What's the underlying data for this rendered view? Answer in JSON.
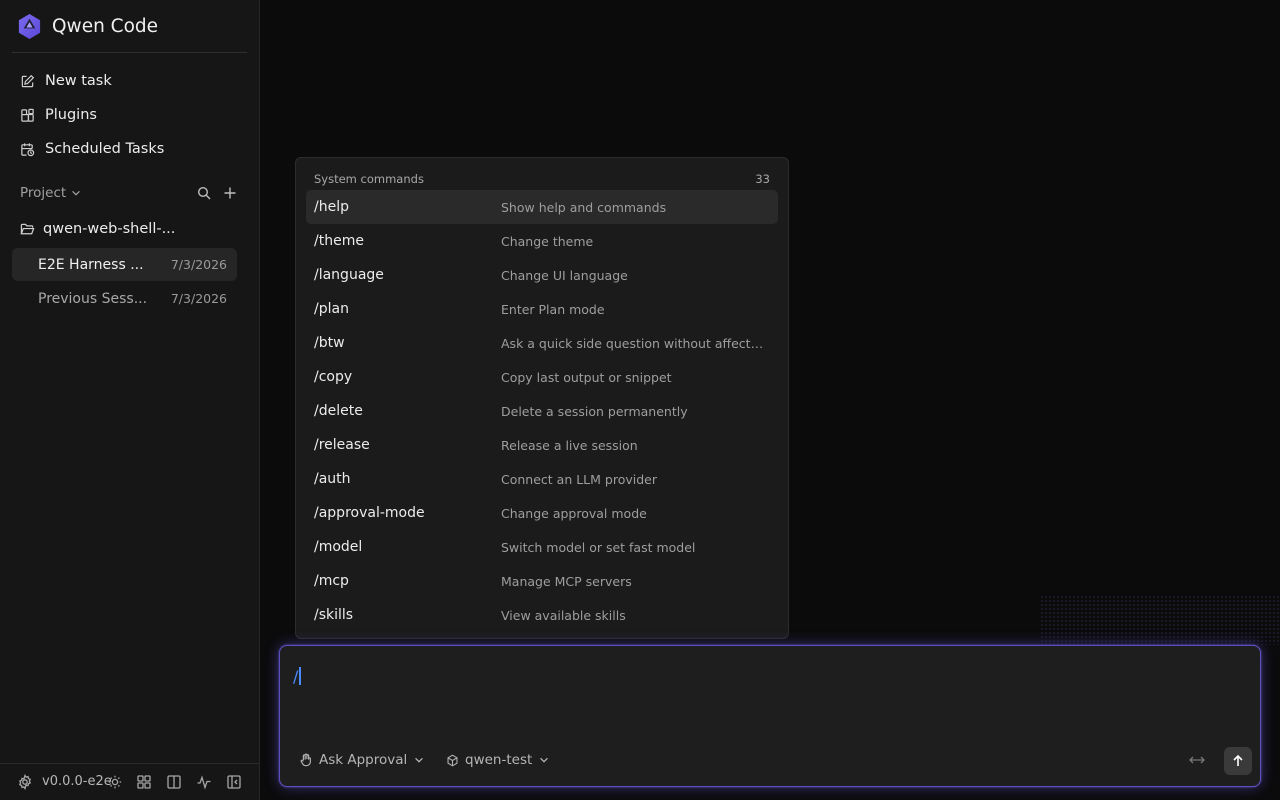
{
  "app": {
    "name": "Qwen Code",
    "version": "v0.0.0-e2e"
  },
  "sidebar": {
    "nav": [
      {
        "label": "New task",
        "icon": "edit-icon"
      },
      {
        "label": "Plugins",
        "icon": "puzzle-icon"
      },
      {
        "label": "Scheduled Tasks",
        "icon": "clock-calendar-icon"
      }
    ],
    "project_label": "Project",
    "folder": "qwen-web-shell-...",
    "sessions": [
      {
        "title": "E2E Harness ...",
        "date": "7/3/2026",
        "active": true
      },
      {
        "title": "Previous Sess...",
        "date": "7/3/2026",
        "active": false
      }
    ]
  },
  "commands": {
    "header": "System commands",
    "count": "33",
    "selected_index": 0,
    "items": [
      {
        "cmd": "/help",
        "desc": "Show help and commands"
      },
      {
        "cmd": "/theme",
        "desc": "Change theme"
      },
      {
        "cmd": "/language",
        "desc": "Change UI language"
      },
      {
        "cmd": "/plan",
        "desc": "Enter Plan mode"
      },
      {
        "cmd": "/btw",
        "desc": "Ask a quick side question without affectin..."
      },
      {
        "cmd": "/copy",
        "desc": "Copy last output or snippet"
      },
      {
        "cmd": "/delete",
        "desc": "Delete a session permanently"
      },
      {
        "cmd": "/release",
        "desc": "Release a live session"
      },
      {
        "cmd": "/auth",
        "desc": "Connect an LLM provider"
      },
      {
        "cmd": "/approval-mode",
        "desc": "Change approval mode"
      },
      {
        "cmd": "/model",
        "desc": "Switch model or set fast model"
      },
      {
        "cmd": "/mcp",
        "desc": "Manage MCP servers"
      },
      {
        "cmd": "/skills",
        "desc": "View available skills"
      }
    ]
  },
  "composer": {
    "value": "/",
    "approval_mode": "Ask Approval",
    "model": "qwen-test"
  },
  "colors": {
    "accent": "#6b5ce7",
    "caret": "#4a8cff"
  }
}
